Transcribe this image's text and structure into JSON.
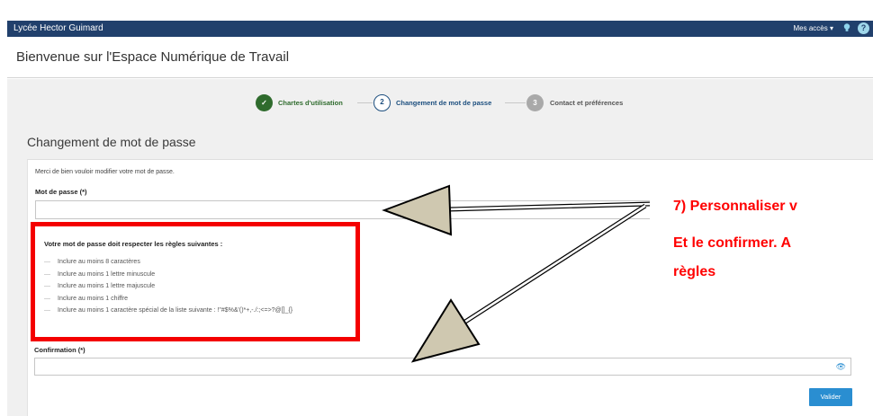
{
  "header": {
    "school_name": "Lycée Hector Guimard",
    "access_menu": "Mes accès ▾",
    "help_icon_glyph": "?"
  },
  "welcome": {
    "title": "Bienvenue sur l'Espace Numérique de Travail"
  },
  "stepper": {
    "steps": [
      {
        "number": "✓",
        "label": "Chartes d'utilisation",
        "state": "done"
      },
      {
        "number": "2",
        "label": "Changement de mot de passe",
        "state": "current"
      },
      {
        "number": "3",
        "label": "Contact et préférences",
        "state": "pending"
      }
    ]
  },
  "form": {
    "section_title": "Changement de mot de passe",
    "intro": "Merci de bien vouloir modifier votre mot de passe.",
    "password_label": "Mot de passe (*)",
    "password_value": "",
    "rules_title": "Votre mot de passe doit respecter les règles suivantes :",
    "rules": [
      "Inclure au moins 8 caractères",
      "Inclure au moins 1 lettre minuscule",
      "Inclure au moins 1 lettre majuscule",
      "Inclure au moins 1 chiffre",
      "Inclure au moins 1 caractère spécial de la liste suivante : !\"#$%&'()*+,-./:;<=>?@[]_{}"
    ],
    "confirm_label": "Confirmation (*)",
    "confirm_value": "",
    "submit_label": "Valider"
  },
  "annotation": {
    "line1": "7) Personnaliser v",
    "line2": "Et le confirmer. A",
    "line3": "règles"
  },
  "colors": {
    "topbar": "#21406c",
    "step_done": "#2f6b2d",
    "step_current": "#1c4e7e",
    "button": "#2a8ed1",
    "annotation_red": "#ff0000"
  }
}
